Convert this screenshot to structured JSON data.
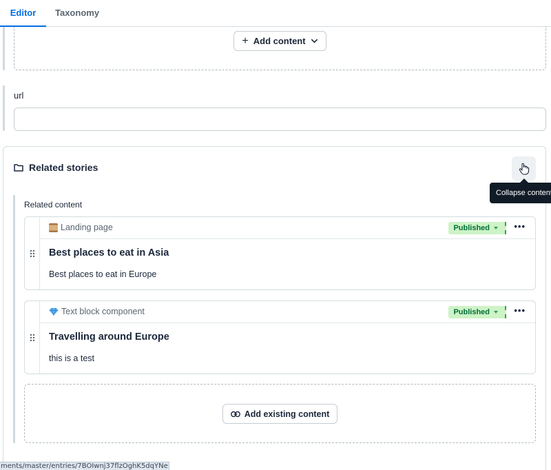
{
  "tabs": [
    {
      "label": "Editor",
      "active": true
    },
    {
      "label": "Taxonomy",
      "active": false
    }
  ],
  "rich_text": {
    "add_content_label": "Add content"
  },
  "url_field": {
    "label": "url",
    "value": ""
  },
  "related": {
    "title": "Related stories",
    "tooltip": "Collapse content",
    "list_label": "Related content",
    "cards": [
      {
        "content_type": "Landing page",
        "content_type_icon": "scroll-emoji",
        "status": "Published",
        "title": "Best places to eat in Asia",
        "description": "Best places to eat in Europe"
      },
      {
        "content_type": "Text block component",
        "content_type_icon": "gem-emoji",
        "status": "Published",
        "title": "Travelling around Europe",
        "description": "this is a test"
      }
    ],
    "add_existing_label": "Add existing content"
  },
  "status_bar": {
    "url": "ments/master/entries/7BOIwnj37flzOghK5dqYNe"
  },
  "colors": {
    "accent": "#036fe3",
    "status_bg": "#cdf3c6",
    "status_text": "#006f39",
    "tooltip_bg": "#111b27"
  }
}
